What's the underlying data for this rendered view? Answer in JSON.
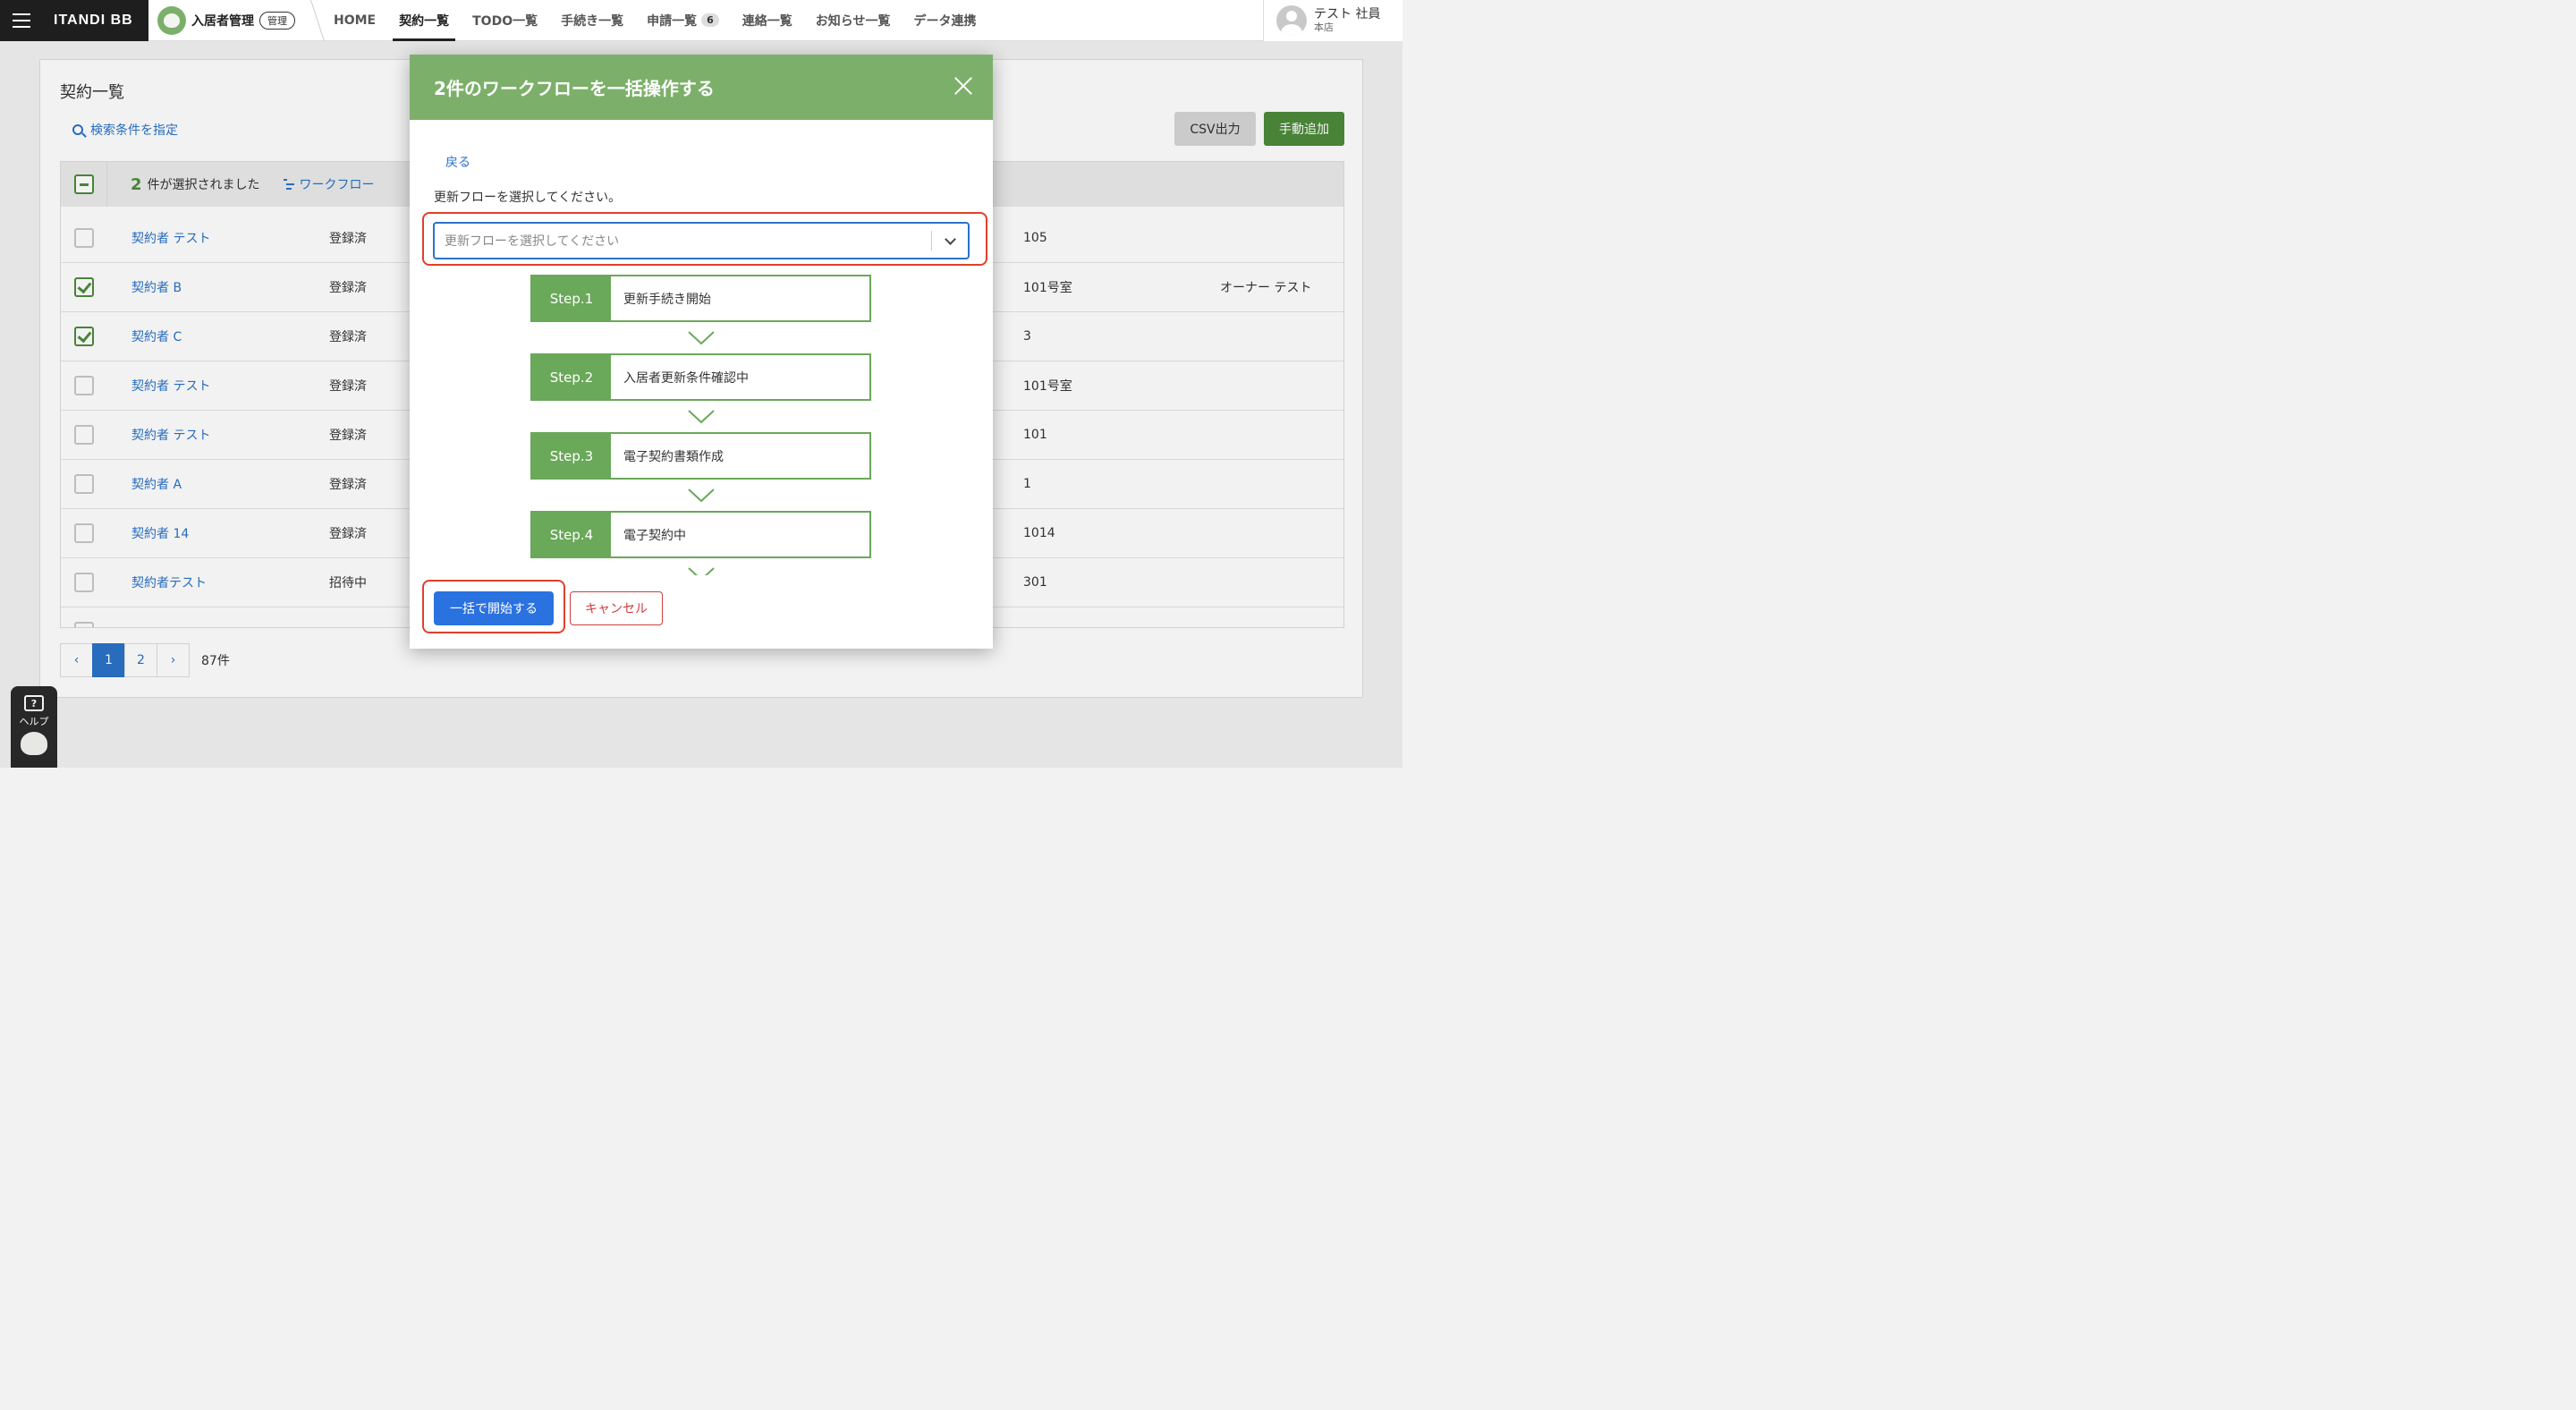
{
  "topbar": {
    "brand": "ITANDI BB",
    "product": "入居者管理",
    "admin_badge": "管理",
    "nav": [
      {
        "label": "HOME"
      },
      {
        "label": "契約一覧"
      },
      {
        "label": "TODO一覧"
      },
      {
        "label": "手続き一覧"
      },
      {
        "label": "申請一覧",
        "count": "6"
      },
      {
        "label": "連絡一覧"
      },
      {
        "label": "お知らせ一覧"
      },
      {
        "label": "データ連携"
      }
    ],
    "active_nav": "契約一覧",
    "user": {
      "name": "テスト 社員",
      "branch": "本店"
    }
  },
  "page": {
    "title": "契約一覧",
    "search_link": "検索条件を指定",
    "csv_button": "CSV出力",
    "add_button": "手動追加",
    "selection": {
      "count": "2",
      "text": "件が選択されました",
      "workflow_link": "ワークフロー"
    },
    "rows": [
      {
        "name": "契約者 テスト",
        "status": "登録済",
        "room": "105",
        "owner": "",
        "checked": false
      },
      {
        "name": "契約者 B",
        "status": "登録済",
        "room": "101号室",
        "owner": "オーナー テスト",
        "checked": true
      },
      {
        "name": "契約者 C",
        "status": "登録済",
        "room": "3",
        "owner": "",
        "checked": true
      },
      {
        "name": "契約者 テスト",
        "status": "登録済",
        "room": "101号室",
        "owner": "",
        "checked": false
      },
      {
        "name": "契約者 テスト",
        "status": "登録済",
        "room": "101",
        "owner": "",
        "checked": false
      },
      {
        "name": "契約者 A",
        "status": "登録済",
        "room": "1",
        "owner": "",
        "checked": false
      },
      {
        "name": "契約者 14",
        "status": "登録済",
        "room": "1014",
        "owner": "",
        "checked": false
      },
      {
        "name": "契約者テスト",
        "status": "招待中",
        "room": "301",
        "owner": "",
        "checked": false
      }
    ],
    "pagination": {
      "prev": "‹",
      "pages": [
        "1",
        "2"
      ],
      "current": "1",
      "next": "›",
      "total": "87件"
    }
  },
  "help": {
    "label": "ヘルプ",
    "icon": "?"
  },
  "modal": {
    "title": "2件のワークフローを一括操作する",
    "back": "戻る",
    "flow_label": "更新フローを選択してください。",
    "select_placeholder": "更新フローを選択してください",
    "steps": [
      {
        "no": "Step.1",
        "name": "更新手続き開始"
      },
      {
        "no": "Step.2",
        "name": "入居者更新条件確認中"
      },
      {
        "no": "Step.3",
        "name": "電子契約書類作成"
      },
      {
        "no": "Step.4",
        "name": "電子契約中"
      }
    ],
    "start_button": "一括で開始する",
    "cancel_button": "キャンセル"
  },
  "colors": {
    "brand_green": "#7cb06a",
    "step_green": "#6aa85a",
    "primary_blue": "#2a72e0",
    "link_blue": "#2a72c8",
    "danger_red": "#d23c3c",
    "highlight_red": "#e0402a"
  },
  "icons": {
    "menu": "hamburger-icon",
    "close": "close-icon",
    "search": "search-icon",
    "dropdown": "chevron-down-icon",
    "workflow": "workflow-icon",
    "step_arrow": "chevron-down-icon"
  }
}
